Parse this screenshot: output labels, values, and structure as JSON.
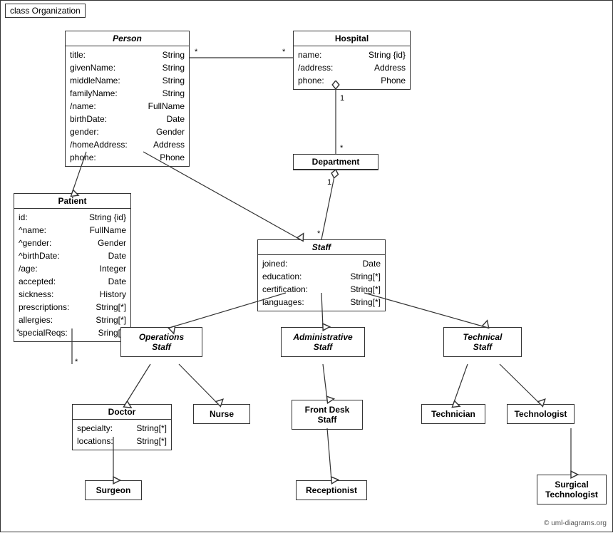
{
  "diagram": {
    "title": "class Organization",
    "copyright": "© uml-diagrams.org",
    "classes": {
      "person": {
        "name": "Person",
        "italic": true,
        "attrs": [
          [
            "title:",
            "String"
          ],
          [
            "givenName:",
            "String"
          ],
          [
            "middleName:",
            "String"
          ],
          [
            "familyName:",
            "String"
          ],
          [
            "/name:",
            "FullName"
          ],
          [
            "birthDate:",
            "Date"
          ],
          [
            "gender:",
            "Gender"
          ],
          [
            "/homeAddress:",
            "Address"
          ],
          [
            "phone:",
            "Phone"
          ]
        ]
      },
      "hospital": {
        "name": "Hospital",
        "italic": false,
        "attrs": [
          [
            "name:",
            "String {id}"
          ],
          [
            "/address:",
            "Address"
          ],
          [
            "phone:",
            "Phone"
          ]
        ]
      },
      "patient": {
        "name": "Patient",
        "italic": false,
        "attrs": [
          [
            "id:",
            "String {id}"
          ],
          [
            "^name:",
            "FullName"
          ],
          [
            "^gender:",
            "Gender"
          ],
          [
            "^birthDate:",
            "Date"
          ],
          [
            "/age:",
            "Integer"
          ],
          [
            "accepted:",
            "Date"
          ],
          [
            "sickness:",
            "History"
          ],
          [
            "prescriptions:",
            "String[*]"
          ],
          [
            "allergies:",
            "String[*]"
          ],
          [
            "specialReqs:",
            "Sring[*]"
          ]
        ]
      },
      "department": {
        "name": "Department",
        "italic": false,
        "attrs": []
      },
      "staff": {
        "name": "Staff",
        "italic": true,
        "attrs": [
          [
            "joined:",
            "Date"
          ],
          [
            "education:",
            "String[*]"
          ],
          [
            "certification:",
            "String[*]"
          ],
          [
            "languages:",
            "String[*]"
          ]
        ]
      },
      "operations_staff": {
        "name": "Operations\nStaff",
        "italic": true,
        "attrs": []
      },
      "administrative_staff": {
        "name": "Administrative\nStaff",
        "italic": true,
        "attrs": []
      },
      "technical_staff": {
        "name": "Technical\nStaff",
        "italic": true,
        "attrs": []
      },
      "doctor": {
        "name": "Doctor",
        "italic": false,
        "attrs": [
          [
            "specialty:",
            "String[*]"
          ],
          [
            "locations:",
            "String[*]"
          ]
        ]
      },
      "nurse": {
        "name": "Nurse",
        "italic": false,
        "attrs": []
      },
      "front_desk_staff": {
        "name": "Front Desk\nStaff",
        "italic": false,
        "attrs": []
      },
      "technician": {
        "name": "Technician",
        "italic": false,
        "attrs": []
      },
      "technologist": {
        "name": "Technologist",
        "italic": false,
        "attrs": []
      },
      "surgeon": {
        "name": "Surgeon",
        "italic": false,
        "attrs": []
      },
      "receptionist": {
        "name": "Receptionist",
        "italic": false,
        "attrs": []
      },
      "surgical_technologist": {
        "name": "Surgical\nTechnologist",
        "italic": false,
        "attrs": []
      }
    }
  }
}
